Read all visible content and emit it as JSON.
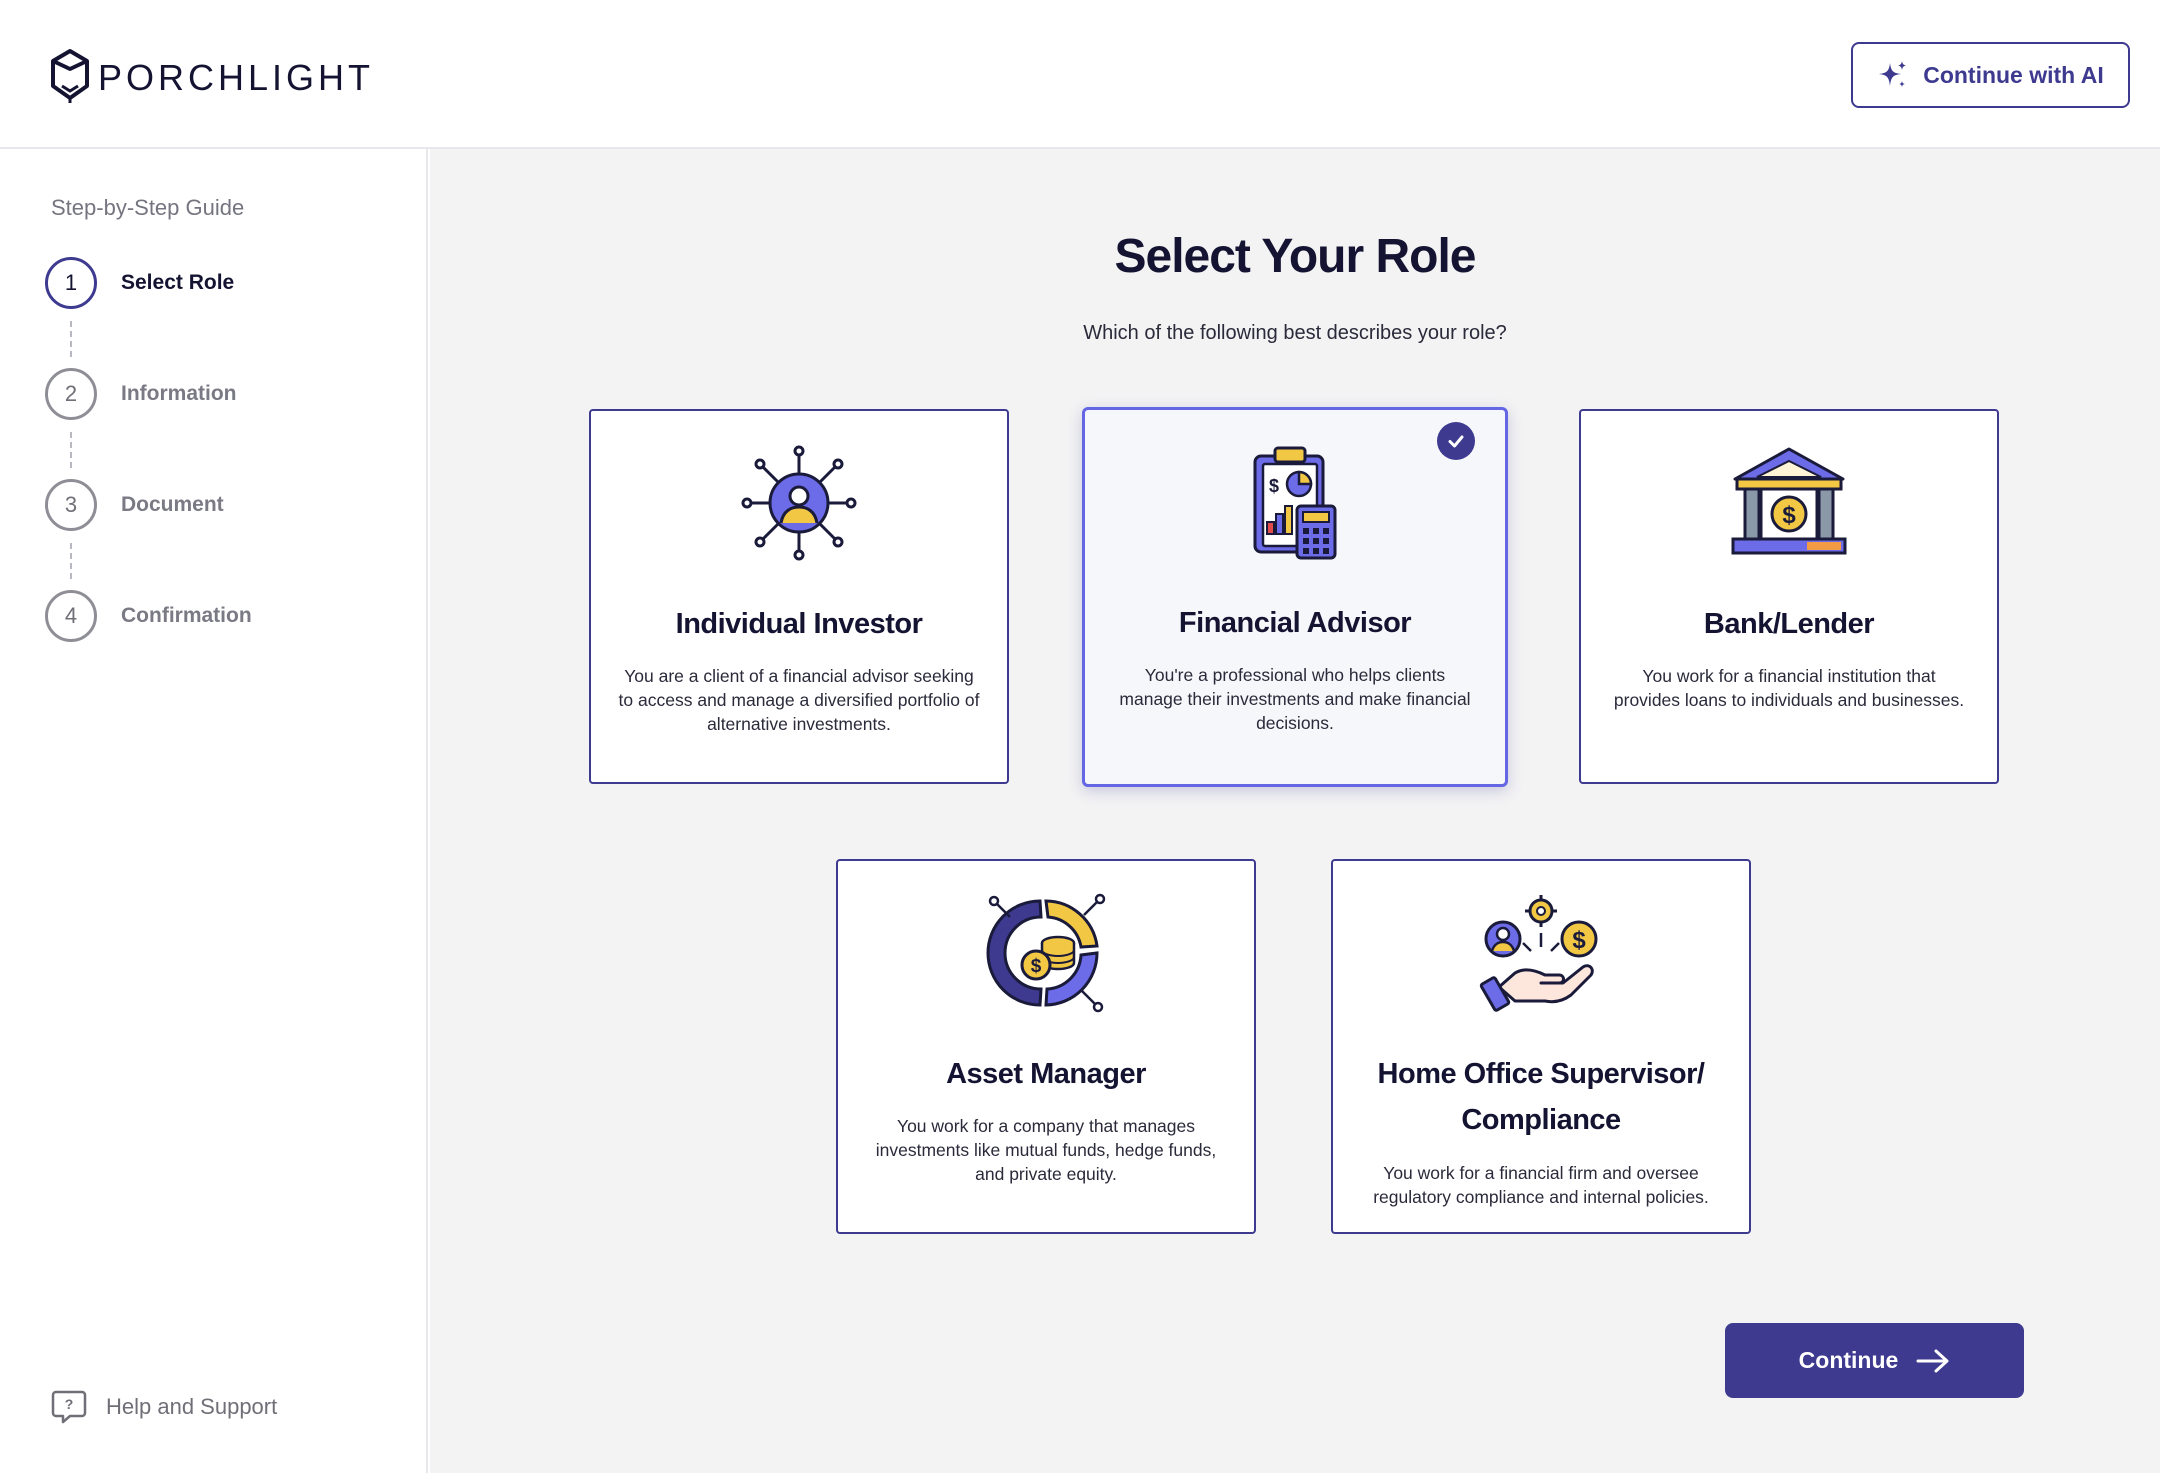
{
  "header": {
    "brand": "PORCHLIGHT",
    "ai_button_label": "Continue with AI"
  },
  "sidebar": {
    "guide_title": "Step-by-Step Guide",
    "steps": [
      {
        "number": "1",
        "label": "Select Role",
        "active": true
      },
      {
        "number": "2",
        "label": "Information",
        "active": false
      },
      {
        "number": "3",
        "label": "Document",
        "active": false
      },
      {
        "number": "4",
        "label": "Confirmation",
        "active": false
      }
    ],
    "help_label": "Help and Support"
  },
  "main": {
    "title": "Select Your Role",
    "subtitle": "Which of the following best describes your role?",
    "selected_role": "Financial Advisor",
    "roles": [
      {
        "title": "Individual Investor",
        "description": "You are a client of a financial advisor seeking to access and manage a diversified portfolio of alternative investments.",
        "icon": "network-person-icon"
      },
      {
        "title": "Financial Advisor",
        "description": "You're a professional who helps clients manage their investments and make financial decisions.",
        "icon": "clipboard-calculator-icon"
      },
      {
        "title": "Bank/Lender",
        "description": "You work for a financial institution that provides loans to individuals and businesses.",
        "icon": "bank-icon"
      },
      {
        "title": "Asset Manager",
        "description": "You work for a company that manages investments like mutual funds, hedge funds, and private equity.",
        "icon": "coins-chart-icon"
      },
      {
        "title": "Home Office Supervisor/ Compliance",
        "description": "You work for a financial firm and oversee regulatory compliance and internal policies.",
        "icon": "hand-gear-dollar-icon"
      }
    ],
    "continue_label": "Continue"
  },
  "colors": {
    "primary": "#3d3a8f",
    "selected_border": "#6466e3",
    "background": "#f3f3f4",
    "accent_yellow": "#f2c744",
    "accent_purple": "#6c6be8"
  }
}
